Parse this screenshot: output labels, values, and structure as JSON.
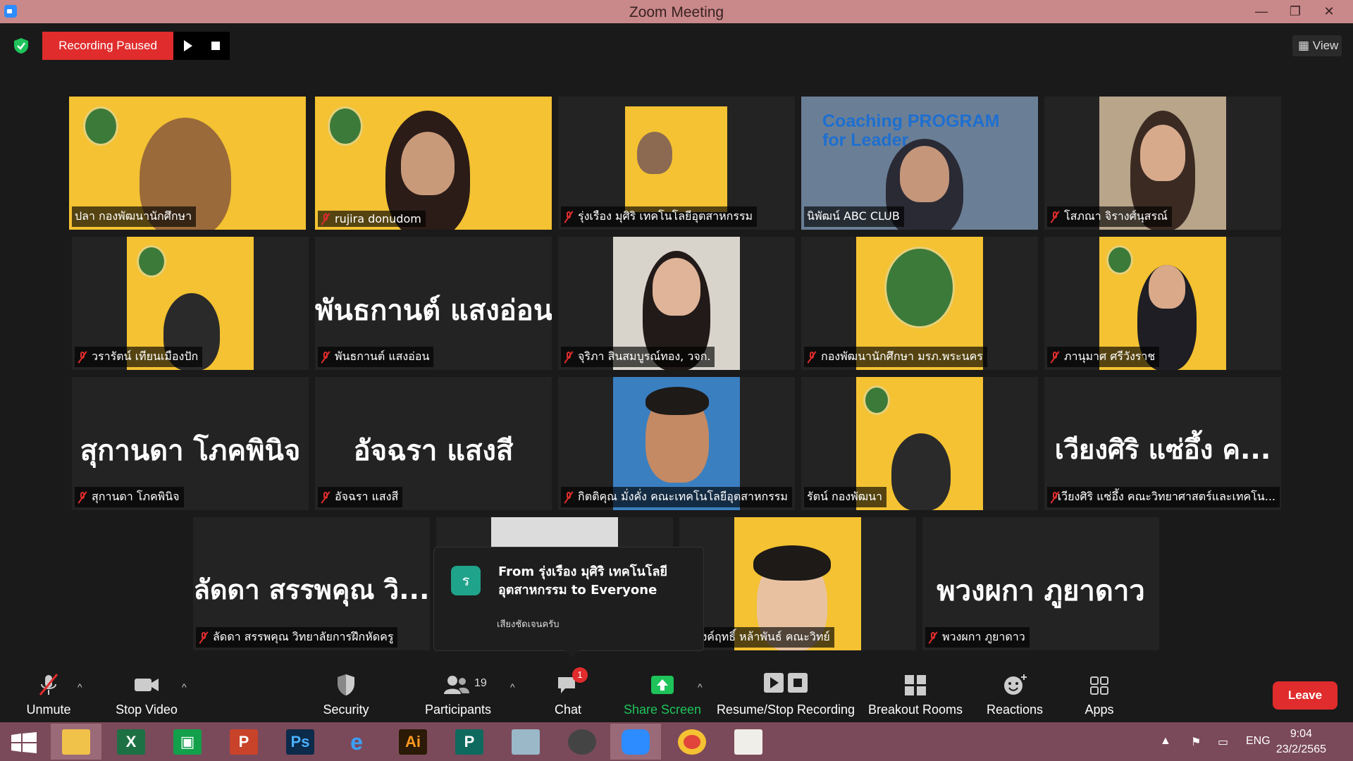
{
  "window": {
    "title": "Zoom Meeting",
    "minimize": "—",
    "restore": "❐",
    "close": "✕"
  },
  "topbar": {
    "recording_status": "Recording Paused",
    "view_label": "View"
  },
  "tiles": [
    {
      "name": "ปลา กองพัฒนานักศึกษา",
      "big": ""
    },
    {
      "name": "rujira donudom",
      "big": ""
    },
    {
      "name": "รุ่งเรือง มุศิริ เทคโนโลยีอุตสาหกรรม",
      "big": ""
    },
    {
      "name": "นิพัฒน์ ABC CLUB",
      "big": "",
      "overlay": "Coaching PROGRAM for Leader"
    },
    {
      "name": "โสภณา จิรางศ์นุสรณ์",
      "big": ""
    },
    {
      "name": "วรารัตน์ เทียนเมืองปัก",
      "big": ""
    },
    {
      "name": "พันธกานต์ แสงอ่อน",
      "big": "พันธกานต์ แสงอ่อน"
    },
    {
      "name": "จุริภา สินสมบูรณ์ทอง, วจก.",
      "big": ""
    },
    {
      "name": "กองพัฒนานักศึกษา มรภ.พระนคร",
      "big": ""
    },
    {
      "name": "ภานุมาศ ศรีวังราช",
      "big": ""
    },
    {
      "name": "สุกานดา โภคพินิจ",
      "big": "สุกานดา โภคพินิจ"
    },
    {
      "name": "อัจฉรา แสงสี",
      "big": "อัจฉรา แสงสี"
    },
    {
      "name": "กิตติคุณ มั่งคั่ง คณะเทคโนโลยีอุตสาหกรรม",
      "big": ""
    },
    {
      "name": "รัตน์ กองพัฒนา",
      "big": ""
    },
    {
      "name": "เวียงศิริ แซ่อึ้ง คณะวิทยาศาสตร์และเทคโน...",
      "big": "เวียงศิริ แซ่อึ้ง ค..."
    },
    {
      "name": "ลัดดา สรรพคุณ วิทยาลัยการฝึกหัดครู",
      "big": "ลัดดา สรรพคุณ วิ..."
    },
    {
      "name": "",
      "big": ""
    },
    {
      "name": "ณรงค์ฤทธิ์ หล้าพันธ์ คณะวิทย์",
      "big": ""
    },
    {
      "name": "พวงผกา ภูยาดาว",
      "big": "พวงผกา ภูยาดาว"
    }
  ],
  "chat_popup": {
    "avatar": "ร",
    "from": "From รุ่งเรือง มุศิริ เทคโนโลยีอุตสาหกรรม to Everyone",
    "message": "เสียงชัดเจนครับ"
  },
  "toolbar": {
    "unmute": "Unmute",
    "stop_video": "Stop Video",
    "security": "Security",
    "participants": "Participants",
    "participants_count": "19",
    "chat": "Chat",
    "chat_badge": "1",
    "share_screen": "Share Screen",
    "recording": "Resume/Stop Recording",
    "breakout": "Breakout Rooms",
    "reactions": "Reactions",
    "apps": "Apps",
    "leave": "Leave"
  },
  "taskbar": {
    "lang": "ENG",
    "time": "9:04",
    "date": "23/2/2565",
    "apps": [
      "windows-start",
      "file-explorer",
      "excel",
      "store",
      "powerpoint",
      "photoshop",
      "internet-explorer",
      "illustrator",
      "publisher",
      "notes",
      "photoscape",
      "zoom",
      "chrome",
      "paint"
    ]
  },
  "colors": {
    "accent_red": "#e02c2c",
    "share_green": "#1ec35a",
    "tile_yellow": "#f4c232",
    "active_border": "#e6e07a"
  }
}
